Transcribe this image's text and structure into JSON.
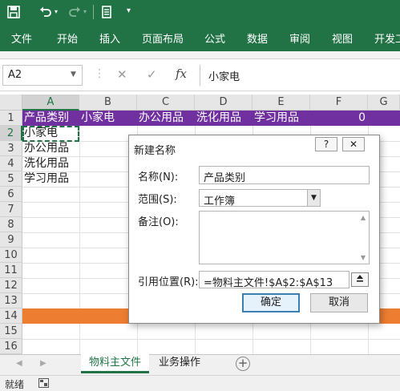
{
  "quick_access": {
    "icons": [
      "save-icon",
      "undo-icon",
      "redo-icon",
      "touch-mode-icon",
      "customize-icon"
    ]
  },
  "ribbon": {
    "tabs": [
      "文件",
      "开始",
      "插入",
      "页面布局",
      "公式",
      "数据",
      "审阅",
      "视图",
      "开发工"
    ]
  },
  "formula_bar": {
    "name_box": "A2",
    "cancel_icon": "✕",
    "enter_icon": "✓",
    "fx": "fx",
    "content": "小家电"
  },
  "grid": {
    "columns": [
      "A",
      "B",
      "C",
      "D",
      "E",
      "F",
      "G"
    ],
    "rows": [
      "1",
      "2",
      "3",
      "4",
      "5",
      "6",
      "7",
      "8",
      "9",
      "10",
      "11",
      "12",
      "13",
      "14",
      "15",
      "16"
    ],
    "row1": [
      "产品类别",
      "小家电",
      "办公用品",
      "洗化用品",
      "学习用品",
      "0"
    ],
    "colA": [
      "小家电",
      "办公用品",
      "洗化用品",
      "学习用品"
    ],
    "row1_color": "#7030a0",
    "row14_color": "#ed7d31"
  },
  "sheet_tabs": {
    "tabs": [
      "物料主文件",
      "业务操作"
    ],
    "active": "物料主文件"
  },
  "status": {
    "text": "就绪"
  },
  "dialog": {
    "title": "新建名称",
    "help": "?",
    "close": "✕",
    "name_label": "名称(N):",
    "name_value": "产品类别",
    "scope_label": "范围(S):",
    "scope_value": "工作簿",
    "comment_label": "备注(O):",
    "comment_value": "",
    "ref_label": "引用位置(R):",
    "ref_value": "=物料主文件!$A$2:$A$13",
    "ok": "确定",
    "cancel": "取消"
  }
}
